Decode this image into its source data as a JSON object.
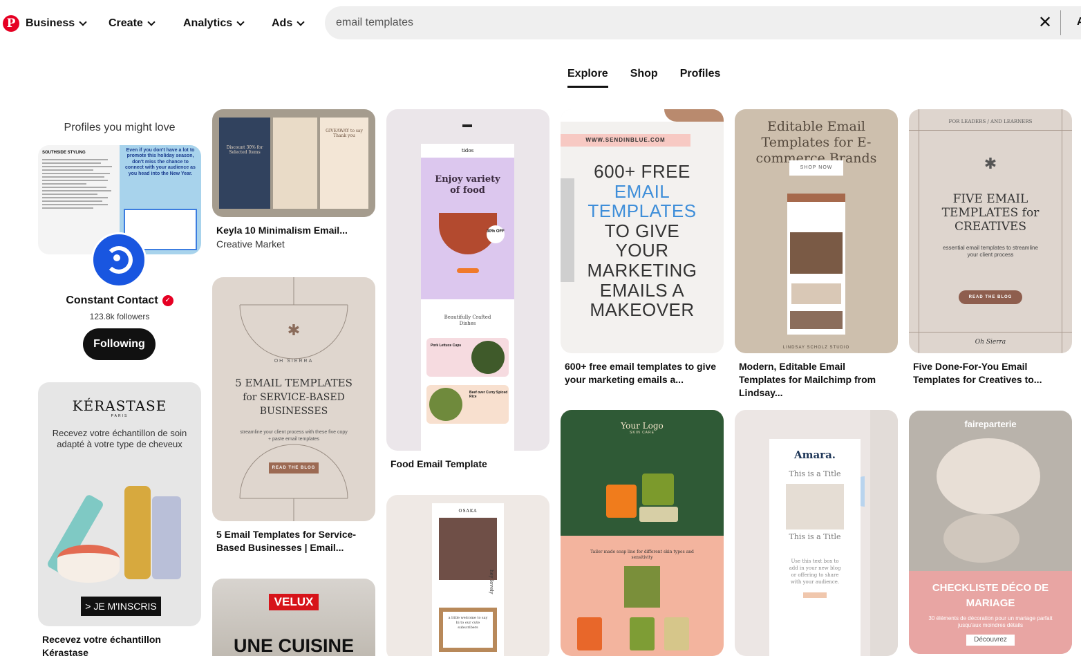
{
  "header": {
    "logo_glyph": "P",
    "nav": [
      "Business",
      "Create",
      "Analytics",
      "Ads"
    ],
    "search_value": "email templates",
    "search_trail": "A"
  },
  "tabs": [
    "Explore",
    "Shop",
    "Profiles"
  ],
  "profiles": {
    "title": "Profiles you might love",
    "collage_right_text": "Even if you don't have a lot to promote this holiday season, don't miss the chance to connect with your audience as you head into the New Year.",
    "collage_left_heading": "SOUTHSIDE STYLING",
    "name": "Constant Contact",
    "followers": "123.8k followers",
    "button": "Following"
  },
  "pins": {
    "p1": {
      "title": "Keyla 10 Minimalism Email...",
      "sub": "Creative Market",
      "img_text": "Discount 30% for Selected Items",
      "img_text2": "GIVEAWAY to say Thank you"
    },
    "p2": {
      "img_brand": "KÉRASTASE",
      "img_city": "PARIS",
      "img_text": "Recevez votre échantillon de soin adapté à votre type de cheveux",
      "img_cta": "> JE M'INSCRIS",
      "title": "Recevez votre échantillon Kérastase"
    },
    "p3": {
      "img_brand": "OH SIERRA",
      "img_title": "5 EMAIL TEMPLATES",
      "img_title2": "for SERVICE-BASED BUSINESSES",
      "img_sub": "streamline your client process with these five copy + paste email templates",
      "img_cta": "READ THE BLOG",
      "title": "5 Email Templates for Service-Based Businesses | Email..."
    },
    "p4": {
      "img_brand": "VELUX",
      "img_text": "UNE CUISINE"
    },
    "p5": {
      "img_logo": "tidos",
      "img_head": "Enjoy variety of food",
      "img_badge": "30% OFF",
      "img_sub": "Beautifully Crafted Dishes",
      "img_item1": "Pork Lettuce Cups",
      "img_item2": "Beef over Curry Spiced Rice",
      "title": "Food Email Template"
    },
    "p6": {
      "img_brand": "OSAKA",
      "img_text": "a little welcome to say hi to our cute subscribers",
      "img_side": "hey lovely"
    },
    "p7": {
      "img_url": "WWW.SENDINBLUE.COM",
      "img_l1": "600+ FREE",
      "img_l2": "EMAIL",
      "img_l3": "TEMPLATES",
      "img_l4": "TO GIVE",
      "img_l5": "YOUR",
      "img_l6": "MARKETING",
      "img_l7": "EMAILS A",
      "img_l8": "MAKEOVER",
      "title": "600+ free email templates to give your marketing emails a..."
    },
    "p8": {
      "img_logo": "Your Logo",
      "img_logo_sub": "SKIN CARE",
      "img_text": "Tailor made soap line for different skin types and sensitivity"
    },
    "p9": {
      "img_title": "Editable Email Templates for E-commerce Brands",
      "img_cta": "SHOP NOW",
      "img_footer": "LINDSAY SCHOLZ STUDIO",
      "title": "Modern, Editable Email Templates for Mailchimp from Lindsay..."
    },
    "p10": {
      "img_brand": "Amara.",
      "img_t1": "This is a Title",
      "img_t2": "This is a Title",
      "img_body": "Use this text box to add in your new blog or offering to share with your audience."
    },
    "p11": {
      "img_top": "FOR LEADERS / AND LEARNERS",
      "img_title": "FIVE EMAIL TEMPLATES for CREATIVES",
      "img_sub": "essential email templates to streamline your client process",
      "img_cta": "READ THE BLOG",
      "img_footer": "Oh Sierra",
      "title": "Five Done-For-You Email Templates for Creatives to..."
    },
    "p12": {
      "img_brand": "faireparterie",
      "img_title": "CHECKLISTE DÉCO DE MARIAGE",
      "img_sub": "30 éléments de décoration pour un mariage parfait jusqu'aux moindres détails",
      "img_cta": "Découvrez"
    }
  },
  "colors": {
    "brand": "#e60023",
    "search_bg": "#efefef",
    "avatar": "#1956e0"
  }
}
